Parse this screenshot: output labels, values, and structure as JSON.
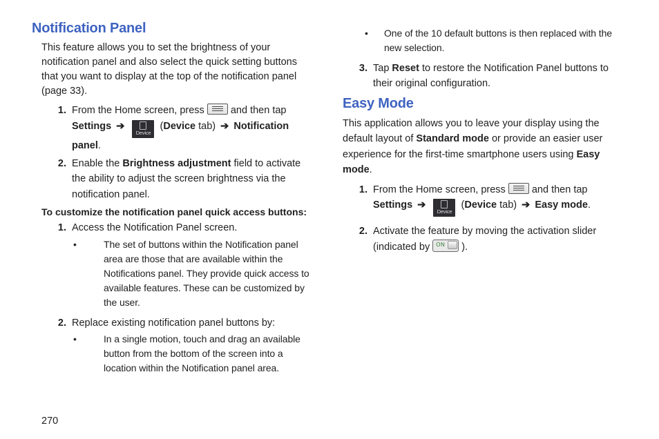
{
  "page_number": "270",
  "left": {
    "heading": "Notification Panel",
    "intro": "This feature allows you to set the brightness of your notification panel and also select the quick setting buttons that you want to display at the top of the notification panel (page 33).",
    "step1_a": "From the Home screen, press ",
    "step1_b": " and then tap ",
    "step1_settings": "Settings",
    "step1_device_open": " (",
    "step1_device_word": "Device",
    "step1_device_close": " tab) ",
    "step1_target": "Notification panel",
    "arrow": "➔",
    "step2_a": "Enable the ",
    "step2_term": "Brightness adjustment",
    "step2_b": " field to activate the ability to adjust the screen brightness via the notification panel.",
    "subhead": "To customize the notification panel quick access buttons:",
    "c_step1": "Access the Notification Panel screen.",
    "c_bullet1": "The set of buttons within the Notification panel area are those that are available within the Notifications panel. They provide quick access to available features. These can be customized by the user.",
    "c_step2": "Replace existing notification panel buttons by:",
    "c_bullet2": "In a single motion, touch and drag an available button from the bottom of the screen into a location within the Notification panel area."
  },
  "right": {
    "top_bullet": "One of the 10 default buttons is then replaced with the new selection.",
    "step3_a": "Tap ",
    "step3_term": "Reset",
    "step3_b": " to restore the Notification Panel buttons to their original configuration.",
    "heading": "Easy Mode",
    "intro_a": "This application allows you to leave your display using the default layout of ",
    "intro_std": "Standard mode",
    "intro_b": " or provide an easier user experience for the first-time smartphone users using ",
    "intro_easy": "Easy mode",
    "intro_c": ".",
    "step1_a": "From the Home screen, press ",
    "step1_b": " and then tap ",
    "step1_settings": "Settings",
    "step1_device_open": " (",
    "step1_device_word": "Device",
    "step1_device_close": " tab) ",
    "step1_target": "Easy mode",
    "arrow": "➔",
    "step2_a": "Activate the feature by moving the activation slider (indicated by ",
    "step2_b": ")."
  }
}
